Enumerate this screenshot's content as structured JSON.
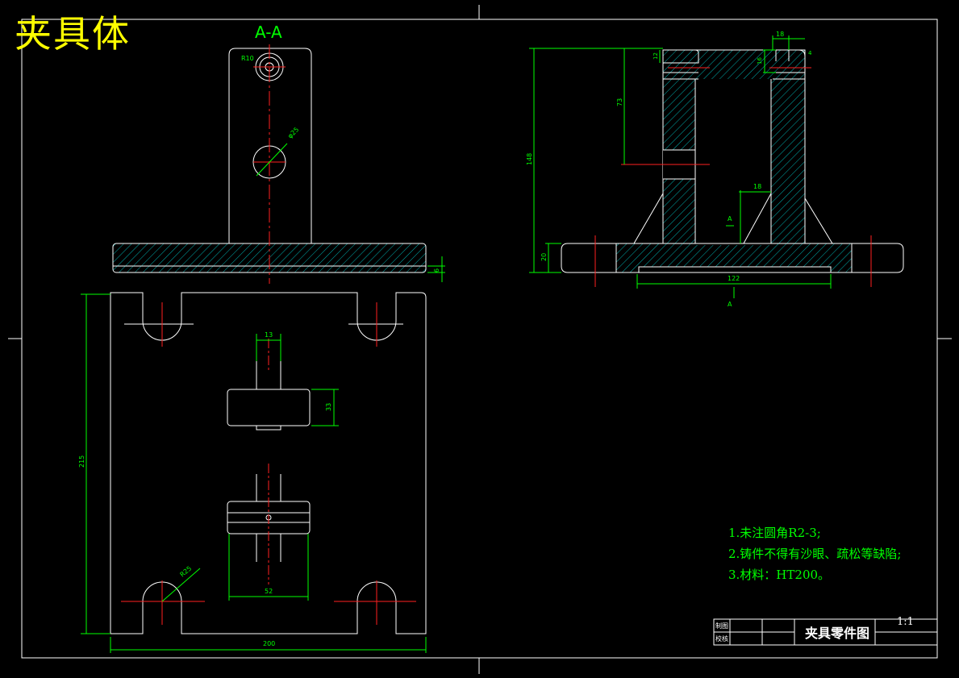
{
  "drawing": {
    "title": "夹具体",
    "section_label": "A-A",
    "dimensions": {
      "r10": "R10",
      "phi25": "φ25",
      "d6": "6",
      "d13": "13",
      "d33": "33",
      "d215": "215",
      "d200": "200",
      "d52": "52",
      "r25": "R25",
      "d18a": "18",
      "d12": "12",
      "d73": "73",
      "d148": "148",
      "d18b": "18",
      "d20": "20",
      "d122": "122",
      "d4": "4",
      "d16": "16",
      "d4b": "4",
      "sec_a1": "A",
      "sec_a2": "A"
    },
    "notes": [
      "1.未注圆角R2-3;",
      "2.铸件不得有沙眼、疏松等缺陷;",
      "3.材料：HT200。"
    ],
    "title_block": {
      "part_name": "夹具零件图",
      "scale": "1:1",
      "drawn_by": "制图",
      "checked_by": "校核"
    }
  }
}
